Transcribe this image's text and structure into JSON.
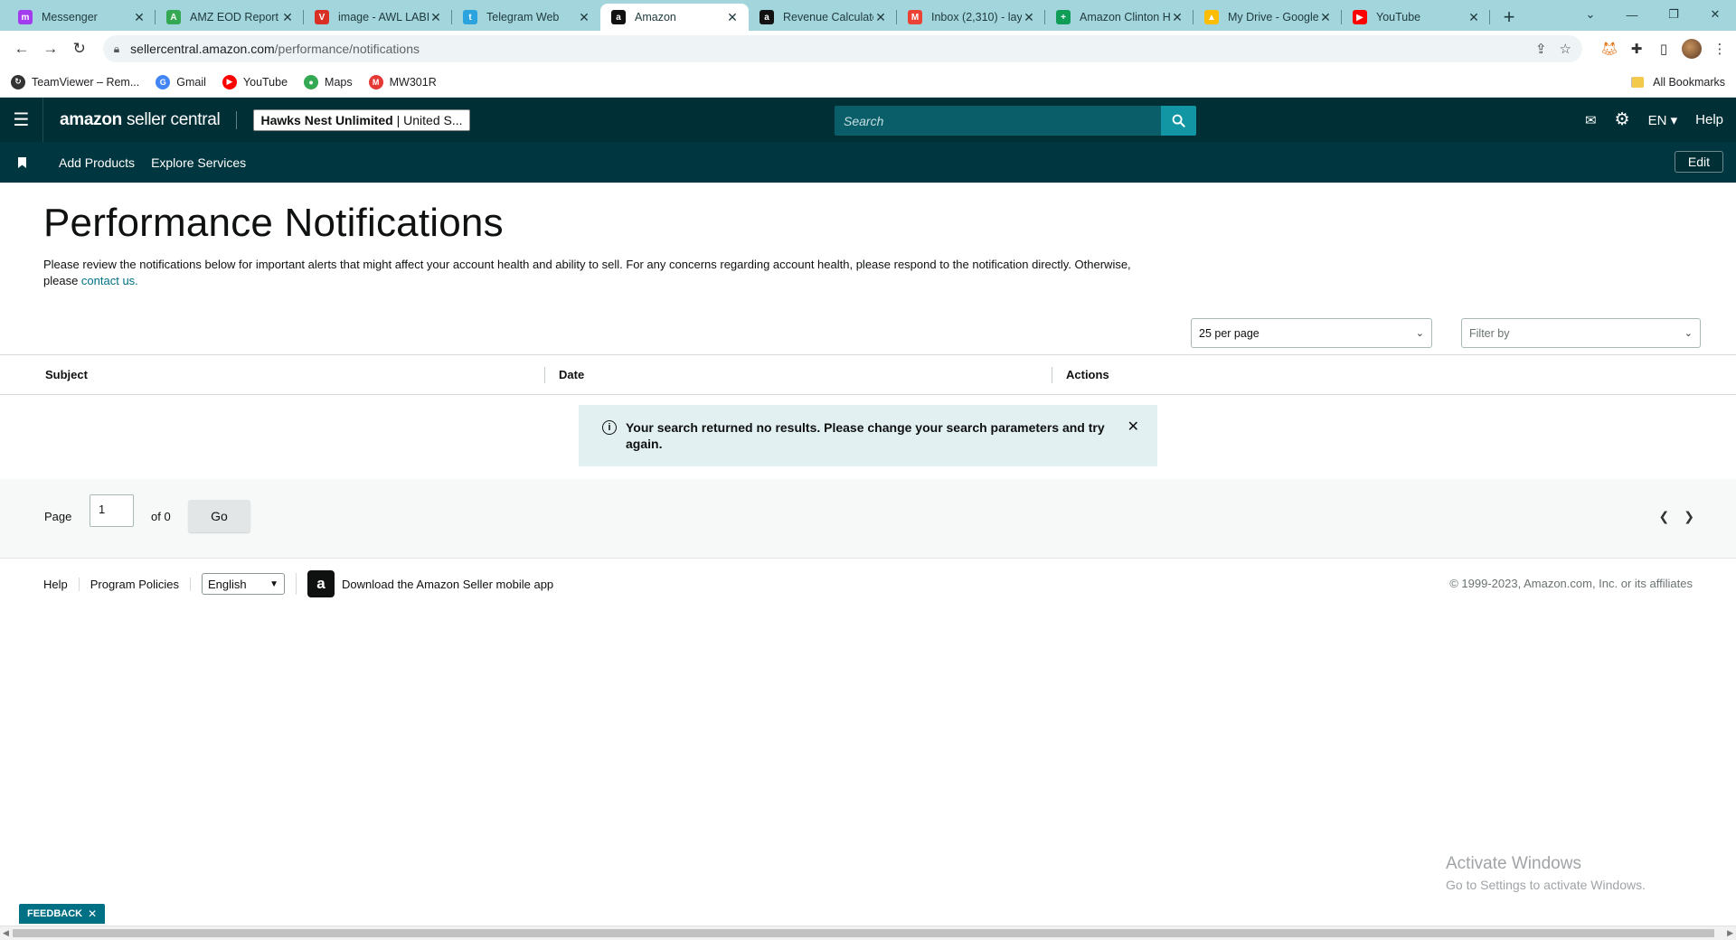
{
  "browser": {
    "tabs": [
      {
        "title": "Messenger",
        "color": "#a33bef",
        "glyph": "m",
        "active": false
      },
      {
        "title": "AMZ EOD Report",
        "color": "#34a853",
        "glyph": "A",
        "active": false
      },
      {
        "title": "image - AWL LABI",
        "color": "#d93025",
        "glyph": "V",
        "active": false
      },
      {
        "title": "Telegram Web",
        "color": "#2aa3df",
        "glyph": "t",
        "active": false
      },
      {
        "title": "Amazon",
        "color": "#111111",
        "glyph": "a",
        "active": true
      },
      {
        "title": "Revenue Calculato",
        "color": "#111111",
        "glyph": "a",
        "active": false
      },
      {
        "title": "Inbox (2,310) - lay",
        "color": "#ea4335",
        "glyph": "M",
        "active": false
      },
      {
        "title": "Amazon Clinton H",
        "color": "#0f9d58",
        "glyph": "+",
        "active": false
      },
      {
        "title": "My Drive - Google",
        "color": "#fbbc04",
        "glyph": "▲",
        "active": false
      },
      {
        "title": "YouTube",
        "color": "#ff0000",
        "glyph": "▶",
        "active": false
      }
    ],
    "url_host": "sellercentral.amazon.com",
    "url_path": "/performance/notifications",
    "bookmarks": [
      {
        "label": "TeamViewer – Rem...",
        "color": "#333333",
        "glyph": "↻"
      },
      {
        "label": "Gmail",
        "color": "#4285f4",
        "glyph": "G"
      },
      {
        "label": "YouTube",
        "color": "#ff0000",
        "glyph": "▶"
      },
      {
        "label": "Maps",
        "color": "#34a853",
        "glyph": "●"
      },
      {
        "label": "MW301R",
        "color": "#e53935",
        "glyph": "M"
      }
    ],
    "all_bookmarks": "All Bookmarks"
  },
  "header": {
    "logo_amazon": "amazon",
    "logo_sc": "seller central",
    "store_name": "Hawks Nest Unlimited",
    "store_region": " | United S...",
    "search_placeholder": "Search",
    "lang": "EN",
    "help": "Help"
  },
  "subnav": {
    "items": [
      "Add Products",
      "Explore Services"
    ],
    "edit": "Edit"
  },
  "page": {
    "title": "Performance Notifications",
    "intro_text": "Please review the notifications below for important alerts that might affect your account health and ability to sell. For any concerns regarding account health, please respond to the notification directly. Otherwise, please ",
    "intro_link": "contact us.",
    "per_page": "25 per page",
    "filter_placeholder": "Filter by"
  },
  "table": {
    "columns": [
      "Subject",
      "Date",
      "Actions"
    ],
    "empty_message": "Your search returned no results. Please change your search parameters and try again."
  },
  "pager": {
    "page_label": "Page",
    "page_value": "1",
    "of_label": "of 0",
    "go": "Go"
  },
  "footer": {
    "help": "Help",
    "program_policies": "Program Policies",
    "language": "English",
    "app_text": "Download the Amazon Seller mobile app",
    "copyright": "© 1999-2023, Amazon.com, Inc. or its affiliates"
  },
  "watermark": {
    "line1": "Activate Windows",
    "line2": "Go to Settings to activate Windows."
  },
  "feedback": "FEEDBACK",
  "colors": {
    "header_bg": "#002f36",
    "subnav_bg": "#00363f",
    "search_btn": "#1296a3",
    "link": "#007185",
    "alert_bg": "#e3f0f1",
    "chrome_bg": "#a3d5dc"
  }
}
